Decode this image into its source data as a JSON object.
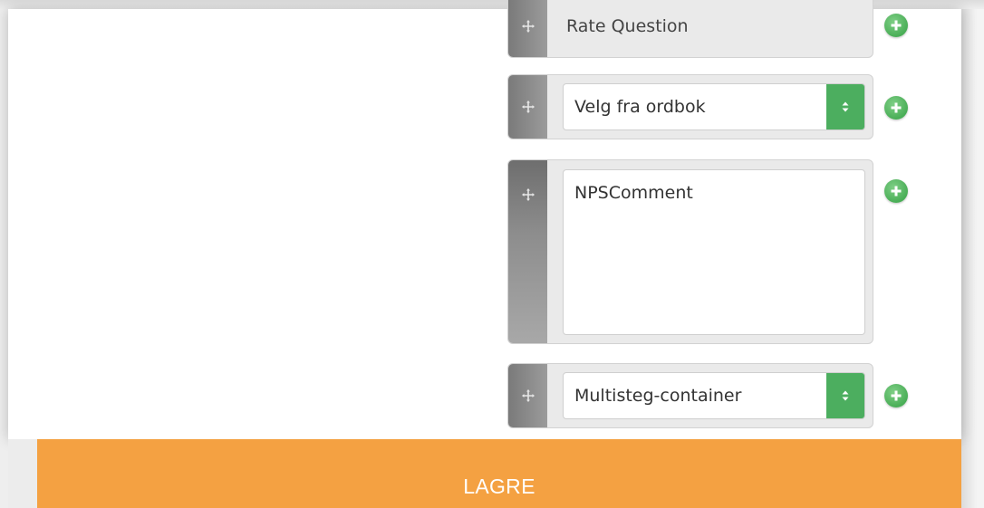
{
  "fields": {
    "rate_question": {
      "label": "Rate Question"
    },
    "dictionary_select": {
      "value": "Velg fra ordbok"
    },
    "nps_comment": {
      "value": "NPSComment"
    },
    "multistep_select": {
      "value": "Multisteg-container"
    }
  },
  "footer": {
    "save_label": "LAGRE"
  },
  "colors": {
    "save_bar": "#f4a142",
    "select_button": "#4cae5f",
    "add_button": "#4aae57",
    "handle": "#8a8a8a"
  },
  "icons": {
    "drag": "move-icon",
    "add": "plus-circle-icon",
    "select_arrows": "updown-arrows-icon"
  }
}
